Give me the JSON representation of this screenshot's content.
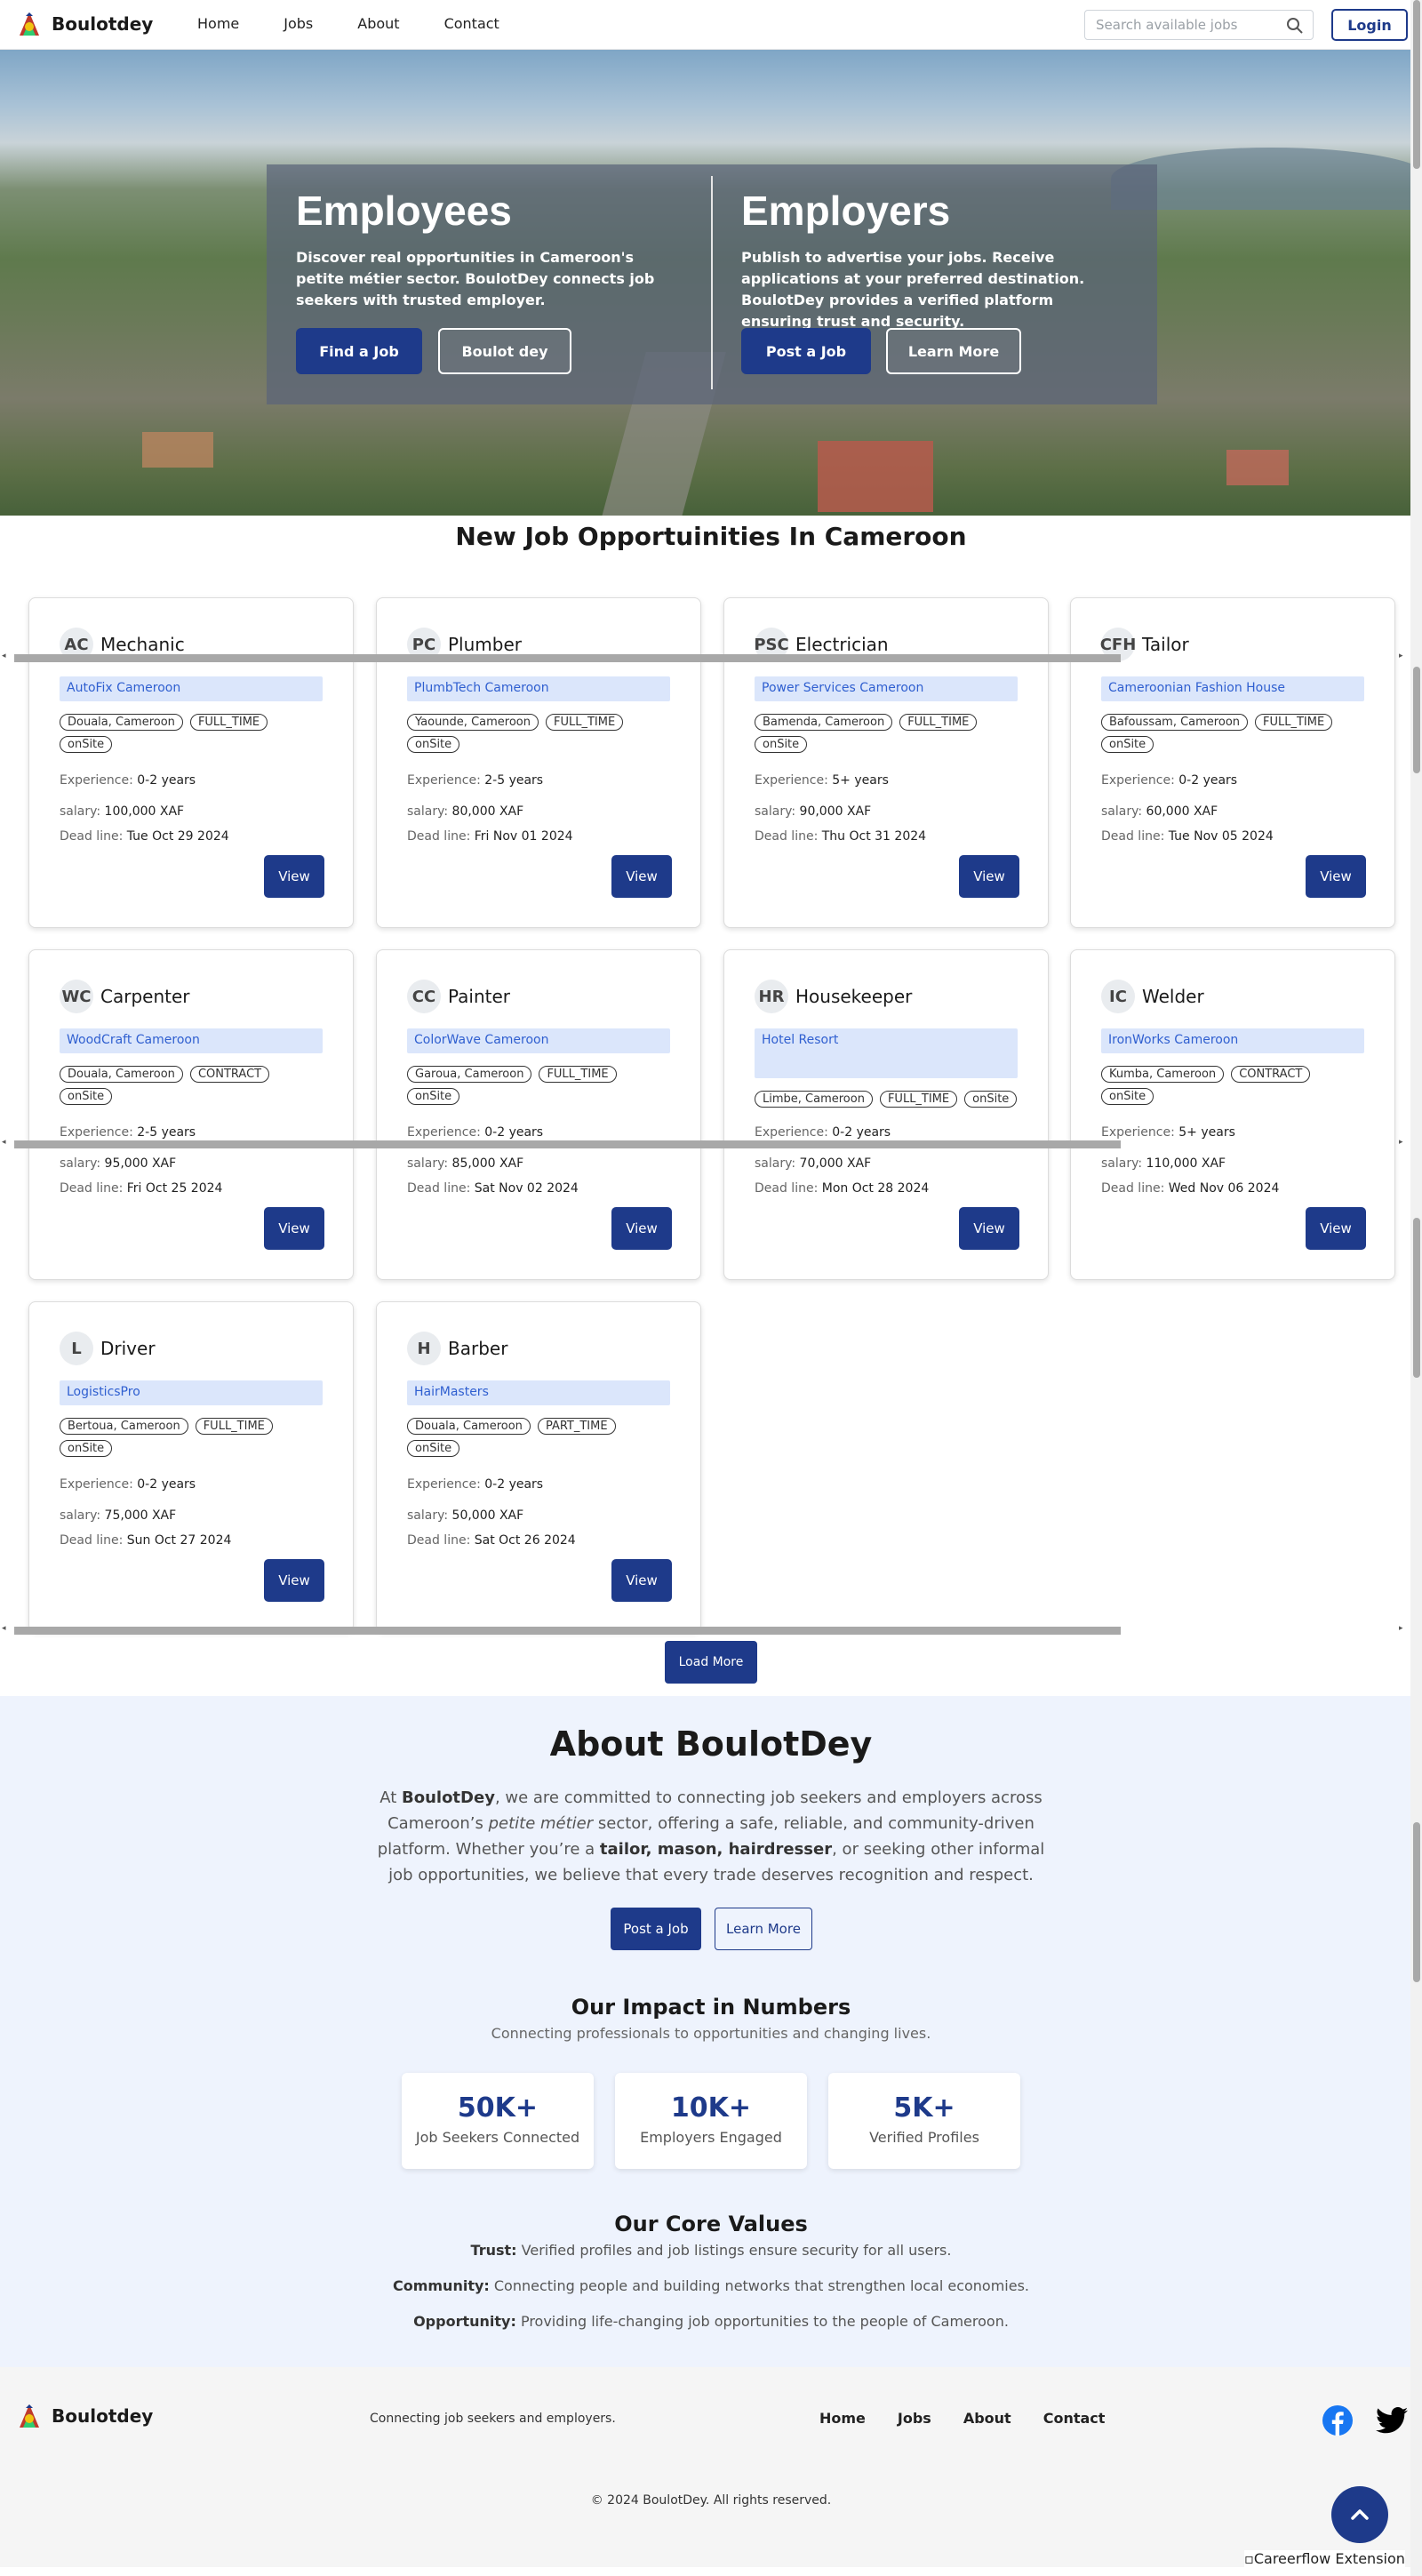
{
  "nav": {
    "brand": "Boulotdey",
    "links": [
      "Home",
      "Jobs",
      "About",
      "Contact"
    ],
    "search_placeholder": "Search available jobs",
    "login": "Login"
  },
  "hero": {
    "employees": {
      "title": "Employees",
      "text": "Discover real opportunities in Cameroon's petite métier sector. BoulotDey connects job seekers with trusted employer.",
      "btn1": "Find a Job",
      "btn2": "Boulot dey"
    },
    "employers": {
      "title": "Employers",
      "text": "Publish to advertise your jobs. Receive applications at your preferred destination. BoulotDey provides a verified platform ensuring trust and security.",
      "btn1": "Post a Job",
      "btn2": "Learn More"
    }
  },
  "jobs": {
    "title": "New Job Opportuinities In Cameroon",
    "exp_label": "Experience: ",
    "salary_label": "salary: ",
    "deadline_label": "Dead line: ",
    "view_label": "View",
    "load_more": "Load More",
    "cards": [
      {
        "initials": "AC",
        "title": "Mechanic",
        "company": "AutoFix Cameroon",
        "location": "Douala, Cameroon",
        "type": "FULL_TIME",
        "mode": "onSite",
        "experience": "0-2 years",
        "salary": "100,000 XAF",
        "deadline": "Tue Oct 29 2024"
      },
      {
        "initials": "PC",
        "title": "Plumber",
        "company": "PlumbTech Cameroon",
        "location": "Yaounde, Cameroon",
        "type": "FULL_TIME",
        "mode": "onSite",
        "experience": "2-5 years",
        "salary": "80,000 XAF",
        "deadline": "Fri Nov 01 2024"
      },
      {
        "initials": "PSC",
        "title": "Electrician",
        "company": "Power Services Cameroon",
        "location": "Bamenda, Cameroon",
        "type": "FULL_TIME",
        "mode": "onSite",
        "experience": "5+ years",
        "salary": "90,000 XAF",
        "deadline": "Thu Oct 31 2024"
      },
      {
        "initials": "CFH",
        "title": "Tailor",
        "company": "Cameroonian Fashion House",
        "location": "Bafoussam, Cameroon",
        "type": "FULL_TIME",
        "mode": "onSite",
        "experience": "0-2 years",
        "salary": "60,000 XAF",
        "deadline": "Tue Nov 05 2024"
      },
      {
        "initials": "WC",
        "title": "Carpenter",
        "company": "WoodCraft Cameroon",
        "location": "Douala, Cameroon",
        "type": "CONTRACT",
        "mode": "onSite",
        "experience": "2-5 years",
        "salary": "95,000 XAF",
        "deadline": "Fri Oct 25 2024"
      },
      {
        "initials": "CC",
        "title": "Painter",
        "company": "ColorWave Cameroon",
        "location": "Garoua, Cameroon",
        "type": "FULL_TIME",
        "mode": "onSite",
        "experience": "0-2 years",
        "salary": "85,000 XAF",
        "deadline": "Sat Nov 02 2024"
      },
      {
        "initials": "HR",
        "title": "Housekeeper",
        "company": "Hotel Resort",
        "location": "Limbe, Cameroon",
        "type": "FULL_TIME",
        "mode": "onSite",
        "experience": "0-2 years",
        "salary": "70,000 XAF",
        "deadline": "Mon Oct 28 2024"
      },
      {
        "initials": "IC",
        "title": "Welder",
        "company": "IronWorks Cameroon",
        "location": "Kumba, Cameroon",
        "type": "CONTRACT",
        "mode": "onSite",
        "experience": "5+ years",
        "salary": "110,000 XAF",
        "deadline": "Wed Nov 06 2024"
      },
      {
        "initials": "L",
        "title": "Driver",
        "company": "LogisticsPro",
        "location": "Bertoua, Cameroon",
        "type": "FULL_TIME",
        "mode": "onSite",
        "experience": "0-2 years",
        "salary": "75,000 XAF",
        "deadline": "Sun Oct 27 2024"
      },
      {
        "initials": "H",
        "title": "Barber",
        "company": "HairMasters",
        "location": "Douala, Cameroon",
        "type": "PART_TIME",
        "mode": "onSite",
        "experience": "0-2 years",
        "salary": "50,000 XAF",
        "deadline": "Sat Oct 26 2024"
      }
    ]
  },
  "about": {
    "title": "About BoulotDey",
    "p_at": "At ",
    "p_brand": "BoulotDey",
    "p_1": ", we are committed to connecting job seekers and employers across Cameroon’s ",
    "p_em": "petite métier",
    "p_2": " sector, offering a safe, reliable, and community-driven platform. Whether you’re a ",
    "p_bold": "tailor, mason, hairdresser",
    "p_3": ", or seeking other informal job opportunities, we believe that every trade deserves recognition and respect.",
    "btn_post": "Post a Job",
    "btn_learn": "Learn More",
    "impact_title": "Our Impact in Numbers",
    "impact_sub": "Connecting professionals to opportunities and changing lives.",
    "stats": [
      {
        "num": "50K+",
        "label": "Job Seekers Connected"
      },
      {
        "num": "10K+",
        "label": "Employers Engaged"
      },
      {
        "num": "5K+",
        "label": "Verified Profiles"
      }
    ],
    "values_title": "Our Core Values",
    "values": [
      {
        "k": "Trust:",
        "v": " Verified profiles and job listings ensure security for all users."
      },
      {
        "k": "Community:",
        "v": " Connecting people and building networks that strengthen local economies."
      },
      {
        "k": "Opportunity:",
        "v": " Providing life-changing job opportunities to the people of Cameroon."
      }
    ]
  },
  "footer": {
    "brand": "Boulotdey",
    "tagline": "Connecting job seekers and employers.",
    "links": [
      "Home",
      "Jobs",
      "About",
      "Contact"
    ],
    "copyright": "© 2024 BoulotDey. All rights reserved.",
    "extension": "Careerflow Extension"
  },
  "colors": {
    "primary": "#1e3a8a",
    "company_bg": "#dbe6fb",
    "about_bg": "#eef3fd",
    "facebook": "#1877f2"
  }
}
